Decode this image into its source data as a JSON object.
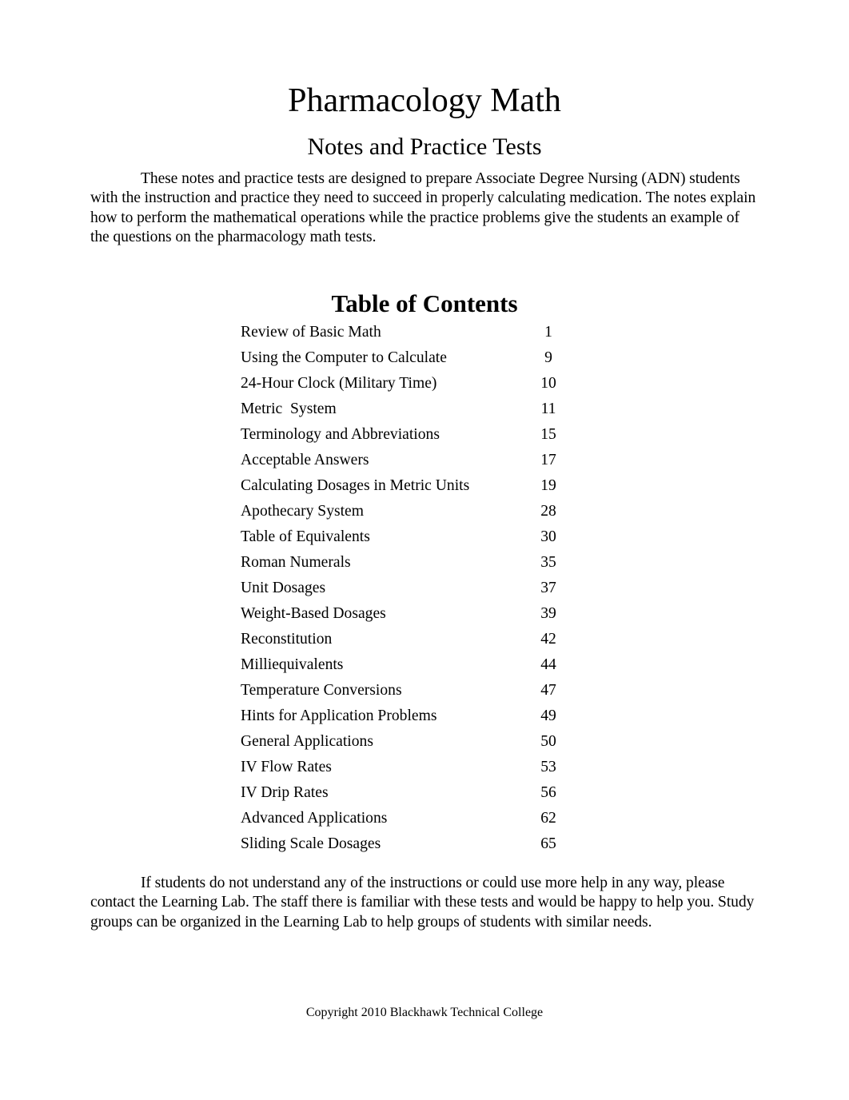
{
  "document": {
    "title": "Pharmacology Math",
    "subtitle": "Notes and Practice Tests",
    "intro": "These notes and practice tests are designed to prepare Associate Degree Nursing (ADN) students with the instruction and practice they need to succeed in properly calculating medication. The notes explain how to perform the mathematical operations while the practice problems give the students an example of the questions on the pharmacology math tests.",
    "toc": {
      "heading": "Table of Contents",
      "entries": [
        {
          "label": "Review of Basic Math",
          "page": "1"
        },
        {
          "label": "Using the Computer to Calculate",
          "page": "9"
        },
        {
          "label": "24-Hour Clock (Military Time)",
          "page": "10"
        },
        {
          "label": "Metric  System",
          "page": "11"
        },
        {
          "label": "Terminology and Abbreviations",
          "page": "15"
        },
        {
          "label": "Acceptable Answers",
          "page": "17"
        },
        {
          "label": "Calculating Dosages in Metric Units",
          "page": "19"
        },
        {
          "label": "Apothecary System",
          "page": "28"
        },
        {
          "label": "Table of Equivalents",
          "page": "30"
        },
        {
          "label": "Roman Numerals",
          "page": "35"
        },
        {
          "label": "Unit Dosages",
          "page": "37"
        },
        {
          "label": "Weight-Based Dosages",
          "page": "39"
        },
        {
          "label": "Reconstitution",
          "page": "42"
        },
        {
          "label": "Milliequivalents",
          "page": "44"
        },
        {
          "label": "Temperature Conversions",
          "page": "47"
        },
        {
          "label": "Hints for Application Problems",
          "page": "49"
        },
        {
          "label": "General Applications",
          "page": "50"
        },
        {
          "label": "IV Flow Rates",
          "page": "53"
        },
        {
          "label": "IV Drip Rates",
          "page": "56"
        },
        {
          "label": "Advanced Applications",
          "page": "62"
        },
        {
          "label": "Sliding Scale Dosages",
          "page": "65"
        }
      ]
    },
    "outro": "If students do not understand any of the instructions or could use more help in any way, please contact the Learning Lab. The staff there is familiar with these tests and would be happy to help you. Study groups can be organized in the Learning Lab to help groups of students with similar needs.",
    "footer": "Copyright 2010 Blackhawk Technical College"
  }
}
